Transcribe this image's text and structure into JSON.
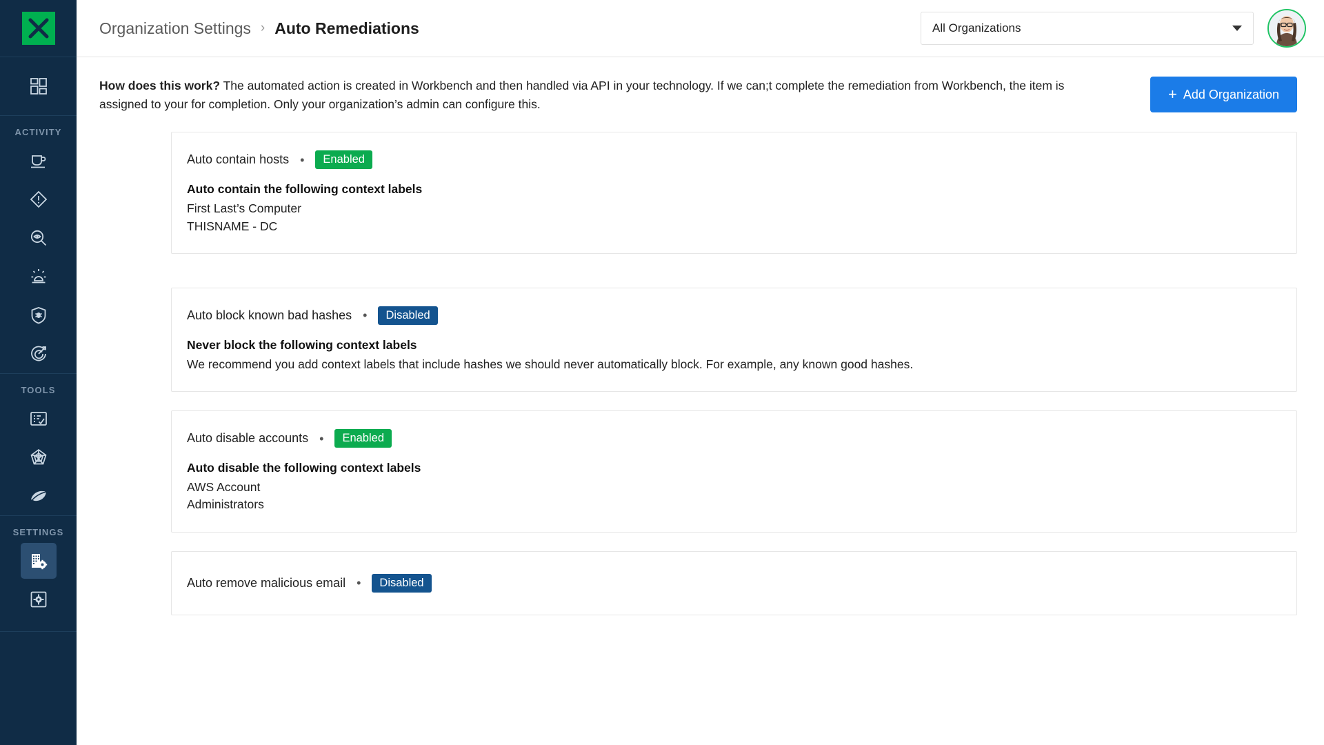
{
  "sidebar": {
    "logo": {
      "icon": "x-logo-icon",
      "color": "#00b050"
    },
    "top_item": {
      "name": "dashboard",
      "icon": "dashboard-grid-icon"
    },
    "sections": [
      {
        "label": "ACTIVITY",
        "items": [
          {
            "name": "workbench",
            "icon": "coffee-cup-icon"
          },
          {
            "name": "alerts",
            "icon": "diamond-alert-icon"
          },
          {
            "name": "threat-hunting",
            "icon": "search-eye-icon"
          },
          {
            "name": "incidents",
            "icon": "siren-icon"
          },
          {
            "name": "malware",
            "icon": "shield-bug-icon"
          },
          {
            "name": "targets",
            "icon": "target-arrow-icon"
          }
        ]
      },
      {
        "label": "TOOLS",
        "items": [
          {
            "name": "checklist",
            "icon": "checklist-icon"
          },
          {
            "name": "attack-surface",
            "icon": "spider-web-icon"
          },
          {
            "name": "leaf",
            "icon": "leaf-icon"
          }
        ]
      },
      {
        "label": "SETTINGS",
        "items": [
          {
            "name": "organization-settings",
            "icon": "building-gear-icon",
            "active": true
          },
          {
            "name": "general-settings",
            "icon": "gear-square-icon",
            "active": false
          }
        ]
      }
    ]
  },
  "topbar": {
    "breadcrumb": {
      "root": "Organization Settings",
      "separator": "›",
      "current": "Auto Remediations"
    },
    "org_selector": {
      "value": "All Organizations",
      "icon": "chevron-down-icon"
    },
    "avatar": {
      "name": "user-avatar",
      "ring_color": "#1fc463"
    }
  },
  "intro": {
    "lead": "How does this work?",
    "body": " The automated action is created in Workbench and then handled via API in your technology. If we can;t complete the remediation from Workbench, the item is assigned to your for completion. Only your organization’s admin can configure this.",
    "add_button": {
      "plus": "+",
      "label": "Add Organization",
      "color": "#1b7ce8"
    }
  },
  "cards": [
    {
      "title": "Auto contain hosts",
      "separator": "•",
      "status": "Enabled",
      "status_type": "enabled",
      "body_title": "Auto contain the following context labels",
      "body_lines": [
        "First Last’s Computer",
        "THISNAME - DC"
      ]
    },
    {
      "title": "Auto block known bad hashes",
      "separator": "•",
      "status": "Disabled",
      "status_type": "disabled",
      "body_title": "Never block the following context labels",
      "body_lines": [
        "We recommend you add context labels that include hashes we should never automatically block. For example, any known good hashes."
      ]
    },
    {
      "title": "Auto disable accounts",
      "separator": "•",
      "status": "Enabled",
      "status_type": "enabled",
      "body_title": "Auto disable the following context labels",
      "body_lines": [
        "AWS Account",
        "Administrators"
      ]
    },
    {
      "title": "Auto remove malicious email",
      "separator": "•",
      "status": "Disabled",
      "status_type": "disabled",
      "body_title": "",
      "body_lines": []
    }
  ],
  "colors": {
    "sidebar_bg": "#102c46",
    "accent_green": "#0cab4f",
    "accent_blue": "#1b7ce8",
    "badge_disabled": "#14548f"
  }
}
